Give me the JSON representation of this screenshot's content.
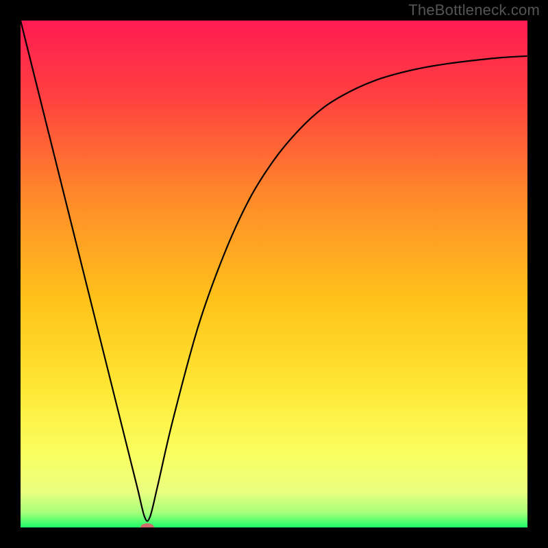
{
  "watermark": "TheBottleneck.com",
  "chart_data": {
    "type": "line",
    "title": "",
    "xlabel": "",
    "ylabel": "",
    "xlim": [
      0,
      1
    ],
    "ylim": [
      0,
      1
    ],
    "background_gradient": {
      "stops": [
        {
          "offset": 0.0,
          "color": "#ff1c52"
        },
        {
          "offset": 0.15,
          "color": "#ff4040"
        },
        {
          "offset": 0.35,
          "color": "#ff8a2a"
        },
        {
          "offset": 0.55,
          "color": "#ffc21a"
        },
        {
          "offset": 0.72,
          "color": "#ffe634"
        },
        {
          "offset": 0.85,
          "color": "#fbff5e"
        },
        {
          "offset": 0.93,
          "color": "#e9ff80"
        },
        {
          "offset": 0.97,
          "color": "#a8ff7a"
        },
        {
          "offset": 1.0,
          "color": "#1dff6a"
        }
      ]
    },
    "series": [
      {
        "name": "curve",
        "x": [
          0.0,
          0.05,
          0.1,
          0.15,
          0.2,
          0.23,
          0.245,
          0.255,
          0.27,
          0.3,
          0.35,
          0.4,
          0.45,
          0.5,
          0.55,
          0.6,
          0.65,
          0.7,
          0.75,
          0.8,
          0.85,
          0.9,
          0.95,
          1.0
        ],
        "y": [
          1.0,
          0.8,
          0.6,
          0.4,
          0.2,
          0.08,
          0.02,
          0.02,
          0.08,
          0.21,
          0.395,
          0.535,
          0.645,
          0.725,
          0.785,
          0.83,
          0.86,
          0.882,
          0.897,
          0.908,
          0.916,
          0.922,
          0.927,
          0.93
        ]
      }
    ],
    "marker": {
      "x": 0.25,
      "y": 0.0,
      "color": "#d06a6a",
      "rx": 10,
      "ry": 6
    },
    "grid": false,
    "legend": false
  }
}
